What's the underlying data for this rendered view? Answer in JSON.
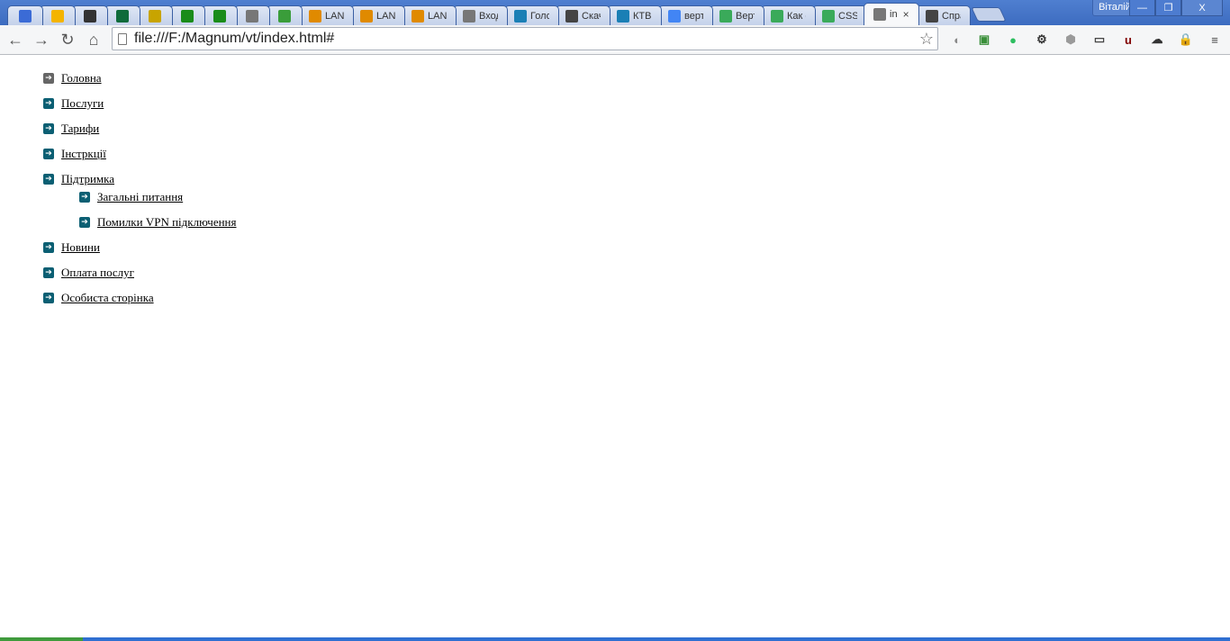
{
  "browser": {
    "tabs": [
      {
        "favicon": "check-app-icon",
        "color": "#3b6bd6",
        "title": ""
      },
      {
        "favicon": "drive-icon",
        "color": "#f4b400",
        "title": ""
      },
      {
        "favicon": "hash-icon",
        "color": "#333333",
        "title": ""
      },
      {
        "favicon": "chart-app-icon",
        "color": "#0f6b3b",
        "title": ""
      },
      {
        "favicon": "clipboard-icon",
        "color": "#c8a400",
        "title": ""
      },
      {
        "favicon": "dollar-icon",
        "color": "#1a8c1a",
        "title": ""
      },
      {
        "favicon": "dollar-icon",
        "color": "#1a8c1a",
        "title": ""
      },
      {
        "favicon": "page-icon",
        "color": "#777777",
        "title": ""
      },
      {
        "favicon": "leaf-p-icon",
        "color": "#3a9d3a",
        "title": ""
      },
      {
        "favicon": "lanbilling-icon",
        "color": "#e08a00",
        "title": "LANB"
      },
      {
        "favicon": "lanbilling-icon",
        "color": "#e08a00",
        "title": "LANB"
      },
      {
        "favicon": "lanbilling-icon",
        "color": "#e08a00",
        "title": "LANB"
      },
      {
        "favicon": "page-icon",
        "color": "#777777",
        "title": "Вход"
      },
      {
        "favicon": "z-icon",
        "color": "#1a7fb5",
        "title": "Голо"
      },
      {
        "favicon": "owl-icon",
        "color": "#444444",
        "title": "Скач"
      },
      {
        "favicon": "z-icon",
        "color": "#1a7fb5",
        "title": "КТВ"
      },
      {
        "favicon": "google-icon",
        "color": "#4285f4",
        "title": "верт"
      },
      {
        "favicon": "house-icon",
        "color": "#3aaa5a",
        "title": "Верт"
      },
      {
        "favicon": "house-icon",
        "color": "#3aaa5a",
        "title": "Как с"
      },
      {
        "favicon": "house-icon",
        "color": "#3aaa5a",
        "title": "CSS |"
      },
      {
        "favicon": "page-icon",
        "color": "#777777",
        "title": "in",
        "active": true
      },
      {
        "favicon": "chat-icon",
        "color": "#444444",
        "title": "Спра"
      }
    ],
    "profile_name": "Віталій",
    "window_buttons": {
      "minimize": "—",
      "maximize": "❐",
      "close": "X"
    },
    "nav": {
      "back": "←",
      "forward": "→",
      "reload": "↻",
      "home": "⌂"
    },
    "url": "file:///F:/Magnum/vt/index.html#",
    "star": "☆",
    "extensions": [
      {
        "name": "search-ext-icon",
        "glyph": "◐",
        "color": "#888888"
      },
      {
        "name": "evernote-clip-icon",
        "glyph": "▣",
        "color": "#3a8f3a"
      },
      {
        "name": "evernote-icon",
        "glyph": "●",
        "color": "#2dbe60"
      },
      {
        "name": "gear-icon",
        "glyph": "⚙",
        "color": "#333333"
      },
      {
        "name": "shield-icon",
        "glyph": "⬢",
        "color": "#9a9a9a"
      },
      {
        "name": "ruler-icon",
        "glyph": "▭",
        "color": "#444444"
      },
      {
        "name": "ublock-icon",
        "glyph": "u",
        "color": "#800000"
      },
      {
        "name": "cloud-icon",
        "glyph": "☁",
        "color": "#333333"
      },
      {
        "name": "lock-icon",
        "glyph": "🔒",
        "color": "#e0a800"
      },
      {
        "name": "menu-icon",
        "glyph": "≡",
        "color": "#444444"
      }
    ]
  },
  "menu": {
    "items": [
      {
        "label": "Головна",
        "visited": true
      },
      {
        "label": "Послуги"
      },
      {
        "label": "Тарифи"
      },
      {
        "label": "Інстркції"
      },
      {
        "label": "Підтримка"
      },
      {
        "label": "Новини"
      },
      {
        "label": "Оплата послуг"
      },
      {
        "label": "Особиста сторінка"
      }
    ],
    "submenu": [
      {
        "label": "Загальні питання"
      },
      {
        "label": "Помилки VPN підключення"
      }
    ],
    "bullet_glyph": "➔",
    "bullet_color": "#0b5f73",
    "bullet_visited_color": "#666666"
  }
}
